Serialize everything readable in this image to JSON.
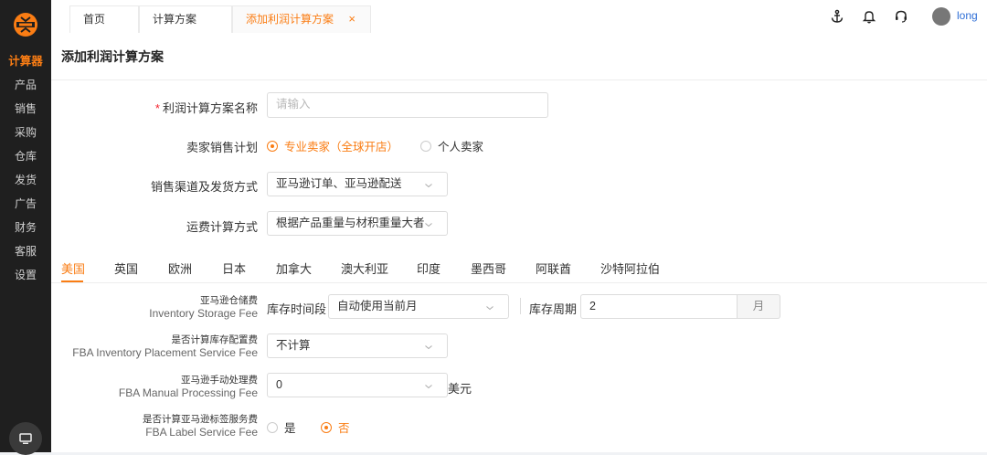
{
  "sidebar": {
    "items": [
      {
        "label": "计算器",
        "active": true
      },
      {
        "label": "产品"
      },
      {
        "label": "销售"
      },
      {
        "label": "采购"
      },
      {
        "label": "仓库"
      },
      {
        "label": "发货"
      },
      {
        "label": "广告"
      },
      {
        "label": "财务"
      },
      {
        "label": "客服"
      },
      {
        "label": "设置"
      }
    ],
    "bottom_icon": "monitor-icon"
  },
  "topbar": {
    "tabs": [
      {
        "label": "首页"
      },
      {
        "label": "计算方案"
      },
      {
        "label": "添加利润计算方案",
        "active": true,
        "close": "×"
      }
    ],
    "icons": [
      "anchor-icon",
      "bell-icon",
      "headset-icon"
    ],
    "user": {
      "name": "long"
    }
  },
  "page": {
    "title": "添加利润计算方案",
    "form": {
      "name": {
        "label": "利润计算方案名称",
        "required": "*",
        "placeholder": "请输入"
      },
      "seller_plan": {
        "label": "卖家销售计划",
        "options": [
          "专业卖家（全球开店）",
          "个人卖家"
        ],
        "selected": 0
      },
      "channel": {
        "label": "销售渠道及发货方式",
        "value": "亚马逊订单、亚马逊配送"
      },
      "freight": {
        "label": "运费计算方式",
        "value": "根据产品重量与材积重量大者"
      }
    },
    "country_tabs": [
      "美国",
      "英国",
      "欧洲",
      "日本",
      "加拿大",
      "澳大利亚",
      "印度",
      "墨西哥",
      "阿联酋",
      "沙特阿拉伯"
    ],
    "fees": {
      "storage": {
        "label_cn": "亚马逊仓储费",
        "label_en": "Inventory Storage Fee",
        "time_label": "库存时间段",
        "time_value": "自动使用当前月",
        "period_label": "库存周期",
        "period_value": "2",
        "period_unit": "月"
      },
      "placement": {
        "label_cn": "是否计算库存配置费",
        "label_en": "FBA Inventory Placement Service Fee",
        "value": "不计算"
      },
      "manual": {
        "label_cn": "亚马逊手动处理费",
        "label_en": "FBA Manual Processing Fee",
        "value": "0",
        "unit": "美元"
      },
      "label_fee": {
        "label_cn": "是否计算亚马逊标签服务费",
        "label_en": "FBA Label Service Fee",
        "options": [
          "是",
          "否"
        ],
        "selected": 1
      }
    }
  },
  "colors": {
    "accent": "#fa7d14",
    "sidebar_bg": "#1f1f1f",
    "link": "#2f6fd6"
  }
}
